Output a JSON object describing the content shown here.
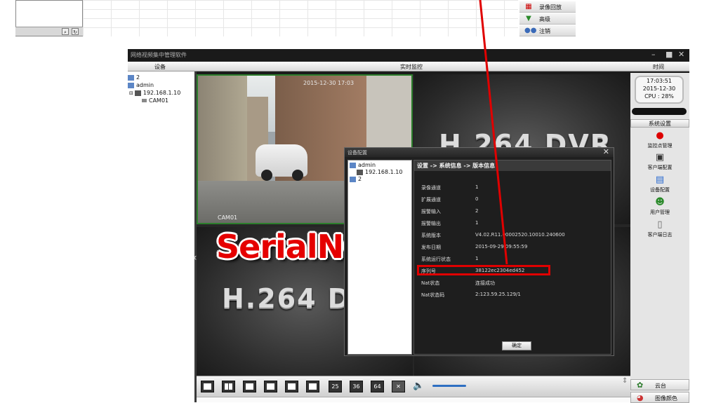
{
  "top_menu": {
    "items": [
      {
        "label": "录像回放",
        "icon": "film-icon"
      },
      {
        "label": "高级",
        "icon": "chevron-down-icon"
      },
      {
        "label": "注销",
        "icon": "users-icon"
      }
    ]
  },
  "app": {
    "title": "网络视频集中管理软件",
    "header": {
      "left": "设备",
      "center": "实时监控",
      "right": "时间"
    },
    "tree": {
      "items": [
        {
          "label": "2"
        },
        {
          "label": "admin"
        },
        {
          "label": "192.168.1.10"
        },
        {
          "label": "CAM01"
        }
      ]
    },
    "video": {
      "camera_label": "CAM01",
      "watermark": "H.264 DVR",
      "watermark_lower": "H.264 D",
      "timestamp": "2015-12-30 17:03"
    },
    "annotation": "SerialNO.",
    "clock": {
      "time": "17:03:51",
      "date": "2015-12-30",
      "cpu": "CPU : 28%"
    },
    "right_panel": {
      "heading": "系统设置",
      "items": [
        {
          "label": "监控点管理",
          "icon": "record-dot-icon"
        },
        {
          "label": "客户端配置",
          "icon": "client-config-icon"
        },
        {
          "label": "设备配置",
          "icon": "device-config-icon"
        },
        {
          "label": "用户管理",
          "icon": "user-management-icon"
        },
        {
          "label": "客户端日志",
          "icon": "log-document-icon"
        }
      ],
      "bottom": [
        {
          "label": "云台",
          "icon": "ptz-icon"
        },
        {
          "label": "图像颜色",
          "icon": "color-palette-icon"
        }
      ]
    },
    "toolbar": {
      "layouts": [
        "1",
        "4",
        "6",
        "8",
        "9",
        "16",
        "25",
        "36",
        "64"
      ],
      "volume_level": 0.75
    }
  },
  "dialog": {
    "title": "设备配置",
    "tree": [
      {
        "label": "admin"
      },
      {
        "label": "192.168.1.10"
      },
      {
        "label": "2"
      }
    ],
    "breadcrumb": "设置 -> 系统信息 -> 版本信息",
    "rows": [
      {
        "label": "录像通道",
        "value": "1"
      },
      {
        "label": "扩展通道",
        "value": "0"
      },
      {
        "label": "报警输入",
        "value": "2"
      },
      {
        "label": "报警输出",
        "value": "1"
      },
      {
        "label": "系统版本",
        "value": "V4.02.R11.00002520.10010.240600"
      },
      {
        "label": "发布日期",
        "value": "2015-09-29 09:55:59"
      },
      {
        "label": "系统运行状态",
        "value": "1"
      },
      {
        "label": "序列号",
        "value": "38122ec2304ed452"
      },
      {
        "label": "Nat状态",
        "value": "连接成功"
      },
      {
        "label": "Nat状态码",
        "value": "2:123.59.25.129/1"
      }
    ],
    "ok_label": "确定"
  }
}
